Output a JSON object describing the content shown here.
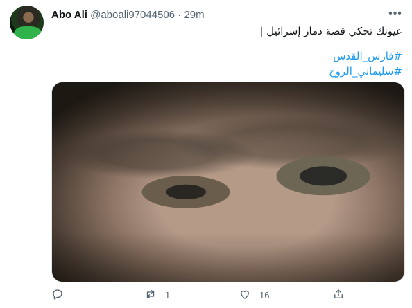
{
  "tweet": {
    "author": {
      "name": "Abo Ali",
      "handle": "@aboali97044506",
      "separator": "·",
      "time": "29m",
      "avatar_icon": "avatar"
    },
    "more_icon": "ellipsis-icon",
    "text": "عيونك تحكي قصة دمار إسرائيل |",
    "hashtags": [
      "#فارس_القدس",
      "#سليماني_الروح"
    ],
    "media": {
      "icon": "photo",
      "description_visible": false
    },
    "actions": {
      "reply": {
        "icon": "reply-icon",
        "count": ""
      },
      "retweet": {
        "icon": "retweet-icon",
        "count": "1"
      },
      "like": {
        "icon": "heart-icon",
        "count": "16"
      },
      "share": {
        "icon": "share-icon",
        "count": ""
      }
    },
    "colors": {
      "link": "#1d9bf0",
      "secondary_text": "#536471",
      "primary_text": "#0f1419"
    }
  }
}
